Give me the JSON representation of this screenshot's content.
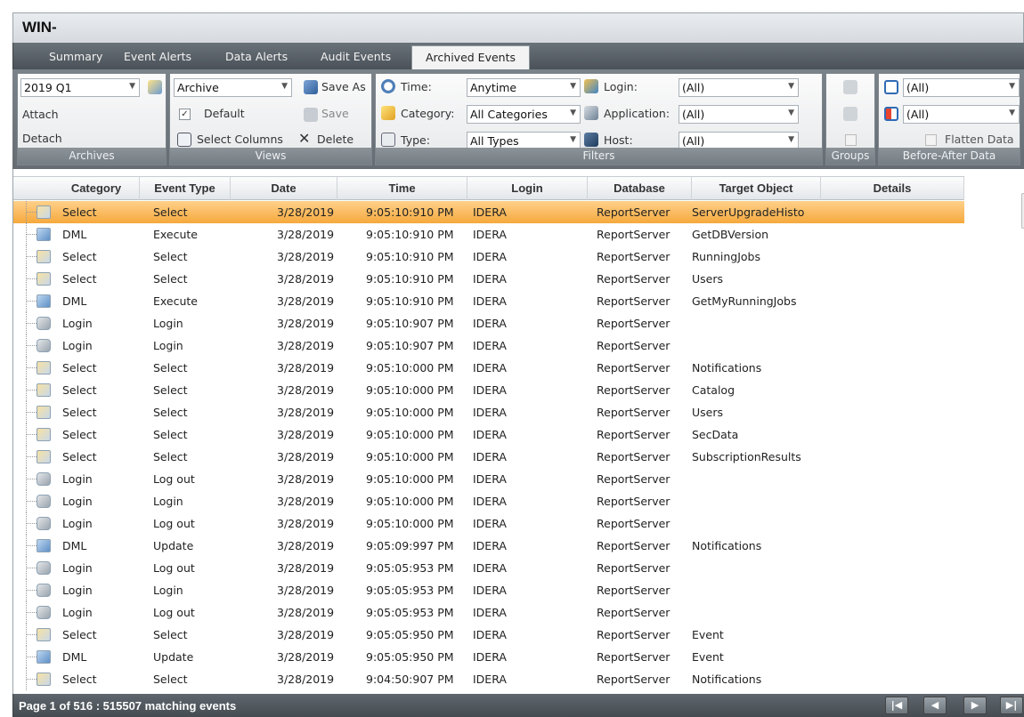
{
  "window": {
    "title": "WIN-"
  },
  "tabs": [
    {
      "label": "Summary"
    },
    {
      "label": "Event Alerts"
    },
    {
      "label": "Data Alerts"
    },
    {
      "label": "Audit Events"
    },
    {
      "label": "Archived Events",
      "active": true
    }
  ],
  "ribbon": {
    "archives": {
      "selected": "2019 Q1",
      "attach_label": "Attach",
      "detach_label": "Detach",
      "group_label": "Archives"
    },
    "views": {
      "selected": "Archive",
      "save_as_label": "Save As",
      "default_label": "Default",
      "default_checked": true,
      "save_label": "Save",
      "select_columns_label": "Select Columns",
      "delete_label": "Delete",
      "group_label": "Views"
    },
    "filters": {
      "time_label": "Time:",
      "time_value": "Anytime",
      "category_label": "Category:",
      "category_value": "All Categories",
      "type_label": "Type:",
      "type_value": "All Types",
      "login_label": "Login:",
      "login_value": "(All)",
      "application_label": "Application:",
      "application_value": "(All)",
      "host_label": "Host:",
      "host_value": "(All)",
      "group_label": "Filters"
    },
    "groups": {
      "group_label": "Groups"
    },
    "before_after": {
      "value1": "(All)",
      "value2": "(All)",
      "flatten_label": "Flatten Data",
      "group_label": "Before-After Data"
    }
  },
  "grid": {
    "columns": [
      "Category",
      "Event Type",
      "Date",
      "Time",
      "Login",
      "Database",
      "Target Object",
      "Details"
    ],
    "rows": [
      {
        "icon": "select",
        "category": "Select",
        "event_type": "Select",
        "date": "3/28/2019",
        "time": "9:05:10:910 PM",
        "login": "IDERA",
        "database": "ReportServer",
        "target": "ServerUpgradeHisto"
      },
      {
        "icon": "dml",
        "category": "DML",
        "event_type": "Execute",
        "date": "3/28/2019",
        "time": "9:05:10:910 PM",
        "login": "IDERA",
        "database": "ReportServer",
        "target": "GetDBVersion"
      },
      {
        "icon": "select",
        "category": "Select",
        "event_type": "Select",
        "date": "3/28/2019",
        "time": "9:05:10:910 PM",
        "login": "IDERA",
        "database": "ReportServer",
        "target": "RunningJobs"
      },
      {
        "icon": "select",
        "category": "Select",
        "event_type": "Select",
        "date": "3/28/2019",
        "time": "9:05:10:910 PM",
        "login": "IDERA",
        "database": "ReportServer",
        "target": "Users"
      },
      {
        "icon": "dml",
        "category": "DML",
        "event_type": "Execute",
        "date": "3/28/2019",
        "time": "9:05:10:910 PM",
        "login": "IDERA",
        "database": "ReportServer",
        "target": "GetMyRunningJobs"
      },
      {
        "icon": "login",
        "category": "Login",
        "event_type": "Login",
        "date": "3/28/2019",
        "time": "9:05:10:907 PM",
        "login": "IDERA",
        "database": "ReportServer",
        "target": ""
      },
      {
        "icon": "login",
        "category": "Login",
        "event_type": "Login",
        "date": "3/28/2019",
        "time": "9:05:10:907 PM",
        "login": "IDERA",
        "database": "ReportServer",
        "target": ""
      },
      {
        "icon": "select",
        "category": "Select",
        "event_type": "Select",
        "date": "3/28/2019",
        "time": "9:05:10:000 PM",
        "login": "IDERA",
        "database": "ReportServer",
        "target": "Notifications"
      },
      {
        "icon": "select",
        "category": "Select",
        "event_type": "Select",
        "date": "3/28/2019",
        "time": "9:05:10:000 PM",
        "login": "IDERA",
        "database": "ReportServer",
        "target": "Catalog"
      },
      {
        "icon": "select",
        "category": "Select",
        "event_type": "Select",
        "date": "3/28/2019",
        "time": "9:05:10:000 PM",
        "login": "IDERA",
        "database": "ReportServer",
        "target": "Users"
      },
      {
        "icon": "select",
        "category": "Select",
        "event_type": "Select",
        "date": "3/28/2019",
        "time": "9:05:10:000 PM",
        "login": "IDERA",
        "database": "ReportServer",
        "target": "SecData"
      },
      {
        "icon": "select",
        "category": "Select",
        "event_type": "Select",
        "date": "3/28/2019",
        "time": "9:05:10:000 PM",
        "login": "IDERA",
        "database": "ReportServer",
        "target": "SubscriptionResults"
      },
      {
        "icon": "login",
        "category": "Login",
        "event_type": "Log out",
        "date": "3/28/2019",
        "time": "9:05:10:000 PM",
        "login": "IDERA",
        "database": "ReportServer",
        "target": ""
      },
      {
        "icon": "login",
        "category": "Login",
        "event_type": "Login",
        "date": "3/28/2019",
        "time": "9:05:10:000 PM",
        "login": "IDERA",
        "database": "ReportServer",
        "target": ""
      },
      {
        "icon": "login",
        "category": "Login",
        "event_type": "Log out",
        "date": "3/28/2019",
        "time": "9:05:10:000 PM",
        "login": "IDERA",
        "database": "ReportServer",
        "target": ""
      },
      {
        "icon": "dml",
        "category": "DML",
        "event_type": "Update",
        "date": "3/28/2019",
        "time": "9:05:09:997 PM",
        "login": "IDERA",
        "database": "ReportServer",
        "target": "Notifications"
      },
      {
        "icon": "login",
        "category": "Login",
        "event_type": "Log out",
        "date": "3/28/2019",
        "time": "9:05:05:953 PM",
        "login": "IDERA",
        "database": "ReportServer",
        "target": ""
      },
      {
        "icon": "login",
        "category": "Login",
        "event_type": "Login",
        "date": "3/28/2019",
        "time": "9:05:05:953 PM",
        "login": "IDERA",
        "database": "ReportServer",
        "target": ""
      },
      {
        "icon": "login",
        "category": "Login",
        "event_type": "Log out",
        "date": "3/28/2019",
        "time": "9:05:05:953 PM",
        "login": "IDERA",
        "database": "ReportServer",
        "target": ""
      },
      {
        "icon": "select",
        "category": "Select",
        "event_type": "Select",
        "date": "3/28/2019",
        "time": "9:05:05:950 PM",
        "login": "IDERA",
        "database": "ReportServer",
        "target": "Event"
      },
      {
        "icon": "dml",
        "category": "DML",
        "event_type": "Update",
        "date": "3/28/2019",
        "time": "9:05:05:950 PM",
        "login": "IDERA",
        "database": "ReportServer",
        "target": "Event"
      },
      {
        "icon": "select",
        "category": "Select",
        "event_type": "Select",
        "date": "3/28/2019",
        "time": "9:04:50:907 PM",
        "login": "IDERA",
        "database": "ReportServer",
        "target": "Notifications"
      }
    ],
    "selected_row": 0
  },
  "status": {
    "text": "Page 1 of 516 : 515507 matching events"
  },
  "colors": {
    "selection": "#f5a93c",
    "tabbar": "#4a5158",
    "ribbon": "#6b737a"
  }
}
